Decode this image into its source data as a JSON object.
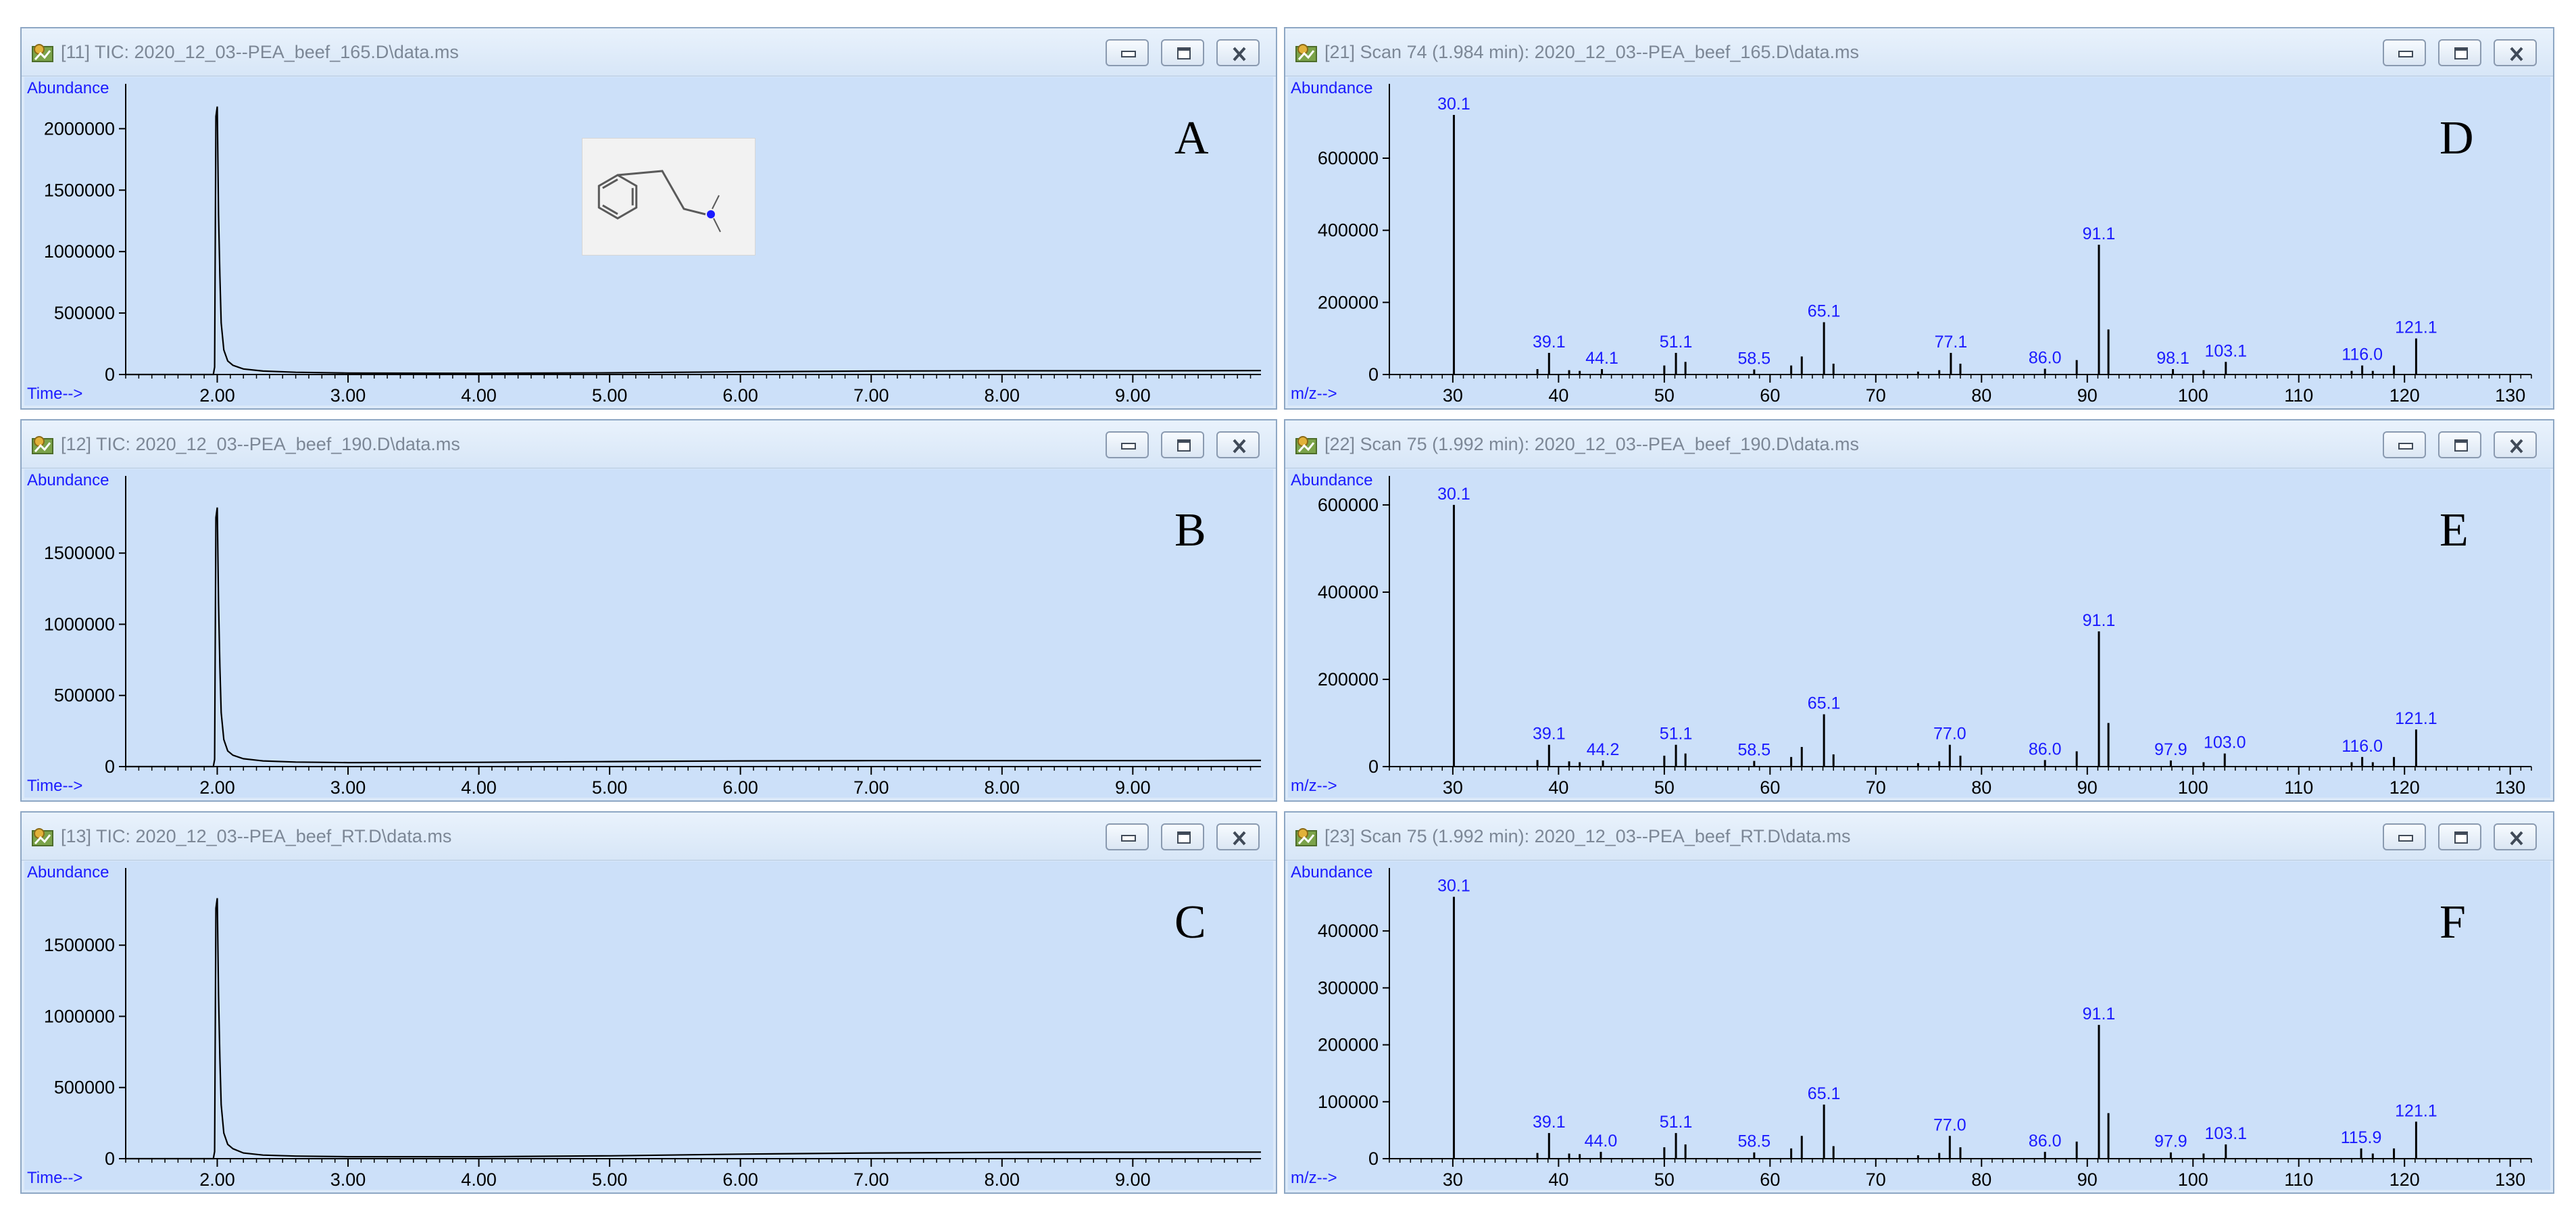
{
  "colors": {
    "plot_bg": "#cce0f9",
    "window_bg": "#dbe9f9",
    "axis": "#000000",
    "peak_label": "#1a1aff",
    "axis_label": "#1a1aff",
    "title_text": "#7c8796"
  },
  "icons": {
    "window_icon": "chemstation-app-icon",
    "minimize": "minimize-icon",
    "maximize": "maximize-icon",
    "close": "close-icon"
  },
  "panels": [
    {
      "letter": "A",
      "title": "[11] TIC: 2020_12_03--PEA_beef_165.D\\data.ms",
      "ylabel": "Abundance",
      "xlabel": "Time-->",
      "structure": "phenethylamine"
    },
    {
      "letter": "B",
      "title": "[12] TIC: 2020_12_03--PEA_beef_190.D\\data.ms",
      "ylabel": "Abundance",
      "xlabel": "Time-->"
    },
    {
      "letter": "C",
      "title": "[13] TIC: 2020_12_03--PEA_beef_RT.D\\data.ms",
      "ylabel": "Abundance",
      "xlabel": "Time-->"
    },
    {
      "letter": "D",
      "title": "[21] Scan 74 (1.984 min): 2020_12_03--PEA_beef_165.D\\data.ms",
      "ylabel": "Abundance",
      "xlabel": "m/z-->"
    },
    {
      "letter": "E",
      "title": "[22] Scan 75 (1.992 min): 2020_12_03--PEA_beef_190.D\\data.ms",
      "ylabel": "Abundance",
      "xlabel": "m/z-->"
    },
    {
      "letter": "F",
      "title": "[23] Scan 75 (1.992 min): 2020_12_03--PEA_beef_RT.D\\data.ms",
      "ylabel": "Abundance",
      "xlabel": "m/z-->"
    }
  ],
  "chart_data": [
    {
      "type": "line",
      "panel": "A",
      "xlabel": "Time-->",
      "ylabel": "Abundance",
      "xlim": [
        1.3,
        9.98
      ],
      "ylim": [
        0,
        2200000
      ],
      "x_ticks": [
        "2.00",
        "3.00",
        "4.00",
        "5.00",
        "6.00",
        "7.00",
        "8.00",
        "9.00"
      ],
      "y_ticks": [
        0,
        500000,
        1000000,
        1500000,
        2000000
      ],
      "series": [
        {
          "x": [
            1.3,
            1.97,
            1.98,
            1.99,
            2.0,
            2.01,
            2.02,
            2.03,
            2.05,
            2.08,
            2.12,
            2.2,
            2.35,
            2.6,
            3.0,
            4.0,
            5.0,
            6.0,
            7.0,
            8.0,
            9.0,
            9.98
          ],
          "y": [
            0,
            0,
            60000,
            2100000,
            2180000,
            1300000,
            800000,
            420000,
            200000,
            110000,
            75000,
            45000,
            28000,
            18000,
            12000,
            10000,
            14000,
            22000,
            28000,
            30000,
            30000,
            32000
          ]
        }
      ]
    },
    {
      "type": "line",
      "panel": "B",
      "xlabel": "Time-->",
      "ylabel": "Abundance",
      "xlim": [
        1.3,
        9.98
      ],
      "ylim": [
        0,
        1900000
      ],
      "x_ticks": [
        "2.00",
        "3.00",
        "4.00",
        "5.00",
        "6.00",
        "7.00",
        "8.00",
        "9.00"
      ],
      "y_ticks": [
        0,
        500000,
        1000000,
        1500000
      ],
      "series": [
        {
          "x": [
            1.3,
            1.97,
            1.98,
            1.99,
            2.0,
            2.01,
            2.02,
            2.03,
            2.05,
            2.08,
            2.12,
            2.2,
            2.35,
            2.6,
            3.0,
            4.0,
            5.0,
            6.0,
            7.0,
            8.0,
            9.0,
            9.98
          ],
          "y": [
            0,
            0,
            50000,
            1750000,
            1820000,
            1150000,
            700000,
            380000,
            190000,
            110000,
            80000,
            55000,
            40000,
            32000,
            28000,
            30000,
            35000,
            40000,
            42000,
            42000,
            42000,
            43000
          ]
        }
      ]
    },
    {
      "type": "line",
      "panel": "C",
      "xlabel": "Time-->",
      "ylabel": "Abundance",
      "xlim": [
        1.3,
        9.98
      ],
      "ylim": [
        0,
        1900000
      ],
      "x_ticks": [
        "2.00",
        "3.00",
        "4.00",
        "5.00",
        "6.00",
        "7.00",
        "8.00",
        "9.00"
      ],
      "y_ticks": [
        0,
        500000,
        1000000,
        1500000
      ],
      "series": [
        {
          "x": [
            1.3,
            1.97,
            1.98,
            1.99,
            2.0,
            2.01,
            2.02,
            2.03,
            2.05,
            2.08,
            2.12,
            2.2,
            2.35,
            2.6,
            3.0,
            4.0,
            5.0,
            6.0,
            7.0,
            8.0,
            9.0,
            9.98
          ],
          "y": [
            0,
            0,
            50000,
            1760000,
            1830000,
            1150000,
            700000,
            380000,
            180000,
            100000,
            70000,
            40000,
            25000,
            18000,
            14000,
            14000,
            20000,
            32000,
            40000,
            44000,
            45000,
            46000
          ]
        }
      ]
    },
    {
      "type": "bar",
      "panel": "D",
      "xlabel": "m/z-->",
      "ylabel": "Abundance",
      "xlim": [
        24,
        132
      ],
      "ylim": [
        0,
        750000
      ],
      "x_ticks": [
        "30",
        "40",
        "50",
        "60",
        "70",
        "80",
        "90",
        "100",
        "110",
        "120",
        "130"
      ],
      "y_ticks": [
        0,
        200000,
        400000,
        600000
      ],
      "peaks": {
        "x": [
          30.1,
          38,
          39.1,
          41,
          42,
          44.1,
          50,
          51.1,
          52,
          58.5,
          62,
          63,
          65.1,
          66,
          74,
          76,
          77.1,
          78,
          86.0,
          89,
          91.1,
          92,
          98.1,
          101,
          103.1,
          115,
          116.0,
          117,
          119,
          121.1
        ],
        "y": [
          720000,
          15000,
          60000,
          12000,
          10000,
          15000,
          25000,
          60000,
          35000,
          14000,
          25000,
          50000,
          145000,
          30000,
          8000,
          12000,
          60000,
          30000,
          16000,
          40000,
          360000,
          125000,
          15000,
          12000,
          35000,
          10000,
          25000,
          10000,
          25000,
          100000
        ]
      },
      "peak_labels": [
        {
          "x": 30.1,
          "text": "30.1"
        },
        {
          "x": 39.1,
          "text": "39.1"
        },
        {
          "x": 44.1,
          "text": "44.1"
        },
        {
          "x": 51.1,
          "text": "51.1"
        },
        {
          "x": 58.5,
          "text": "58.5"
        },
        {
          "x": 65.1,
          "text": "65.1"
        },
        {
          "x": 77.1,
          "text": "77.1"
        },
        {
          "x": 86.0,
          "text": "86.0"
        },
        {
          "x": 91.1,
          "text": "91.1"
        },
        {
          "x": 98.1,
          "text": "98.1"
        },
        {
          "x": 103.1,
          "text": "103.1"
        },
        {
          "x": 116.0,
          "text": "116.0"
        },
        {
          "x": 121.1,
          "text": "121.1"
        }
      ]
    },
    {
      "type": "bar",
      "panel": "E",
      "xlabel": "m/z-->",
      "ylabel": "Abundance",
      "xlim": [
        24,
        132
      ],
      "ylim": [
        0,
        620000
      ],
      "x_ticks": [
        "30",
        "40",
        "50",
        "60",
        "70",
        "80",
        "90",
        "100",
        "110",
        "120",
        "130"
      ],
      "y_ticks": [
        0,
        200000,
        400000,
        600000
      ],
      "peaks": {
        "x": [
          30.1,
          38,
          39.1,
          41,
          42,
          44.2,
          50,
          51.1,
          52,
          58.5,
          62,
          63,
          65.1,
          66,
          74,
          76,
          77.0,
          78,
          86.0,
          89,
          91.1,
          92,
          97.9,
          101,
          103.0,
          115,
          116.0,
          117,
          119,
          121.1
        ],
        "y": [
          600000,
          15000,
          50000,
          12000,
          10000,
          14000,
          25000,
          50000,
          30000,
          13000,
          22000,
          45000,
          120000,
          28000,
          8000,
          12000,
          50000,
          25000,
          15000,
          35000,
          310000,
          100000,
          14000,
          10000,
          30000,
          10000,
          22000,
          10000,
          22000,
          85000
        ]
      },
      "peak_labels": [
        {
          "x": 30.1,
          "text": "30.1"
        },
        {
          "x": 39.1,
          "text": "39.1"
        },
        {
          "x": 44.2,
          "text": "44.2"
        },
        {
          "x": 51.1,
          "text": "51.1"
        },
        {
          "x": 58.5,
          "text": "58.5"
        },
        {
          "x": 65.1,
          "text": "65.1"
        },
        {
          "x": 77.0,
          "text": "77.0"
        },
        {
          "x": 86.0,
          "text": "86.0"
        },
        {
          "x": 91.1,
          "text": "91.1"
        },
        {
          "x": 97.9,
          "text": "97.9"
        },
        {
          "x": 103.0,
          "text": "103.0"
        },
        {
          "x": 116.0,
          "text": "116.0"
        },
        {
          "x": 121.1,
          "text": "121.1"
        }
      ]
    },
    {
      "type": "bar",
      "panel": "F",
      "xlabel": "m/z-->",
      "ylabel": "Abundance",
      "xlim": [
        24,
        132
      ],
      "ylim": [
        0,
        475000
      ],
      "x_ticks": [
        "30",
        "40",
        "50",
        "60",
        "70",
        "80",
        "90",
        "100",
        "110",
        "120",
        "130"
      ],
      "y_ticks": [
        0,
        100000,
        200000,
        300000,
        400000
      ],
      "peaks": {
        "x": [
          30.1,
          38,
          39.1,
          41,
          42,
          44.0,
          50,
          51.1,
          52,
          58.5,
          62,
          63,
          65.1,
          66,
          74,
          76,
          77.0,
          78,
          86.0,
          89,
          91.1,
          92,
          97.9,
          101,
          103.1,
          115.9,
          117,
          119,
          121.1
        ],
        "y": [
          460000,
          10000,
          45000,
          9000,
          8000,
          12000,
          20000,
          45000,
          25000,
          11000,
          18000,
          40000,
          95000,
          22000,
          6000,
          10000,
          40000,
          20000,
          12000,
          30000,
          235000,
          80000,
          11000,
          9000,
          25000,
          18000,
          9000,
          18000,
          65000
        ]
      },
      "peak_labels": [
        {
          "x": 30.1,
          "text": "30.1"
        },
        {
          "x": 39.1,
          "text": "39.1"
        },
        {
          "x": 44.0,
          "text": "44.0"
        },
        {
          "x": 51.1,
          "text": "51.1"
        },
        {
          "x": 58.5,
          "text": "58.5"
        },
        {
          "x": 65.1,
          "text": "65.1"
        },
        {
          "x": 77.0,
          "text": "77.0"
        },
        {
          "x": 86.0,
          "text": "86.0"
        },
        {
          "x": 91.1,
          "text": "91.1"
        },
        {
          "x": 97.9,
          "text": "97.9"
        },
        {
          "x": 103.1,
          "text": "103.1"
        },
        {
          "x": 115.9,
          "text": "115.9"
        },
        {
          "x": 121.1,
          "text": "121.1"
        }
      ]
    }
  ]
}
